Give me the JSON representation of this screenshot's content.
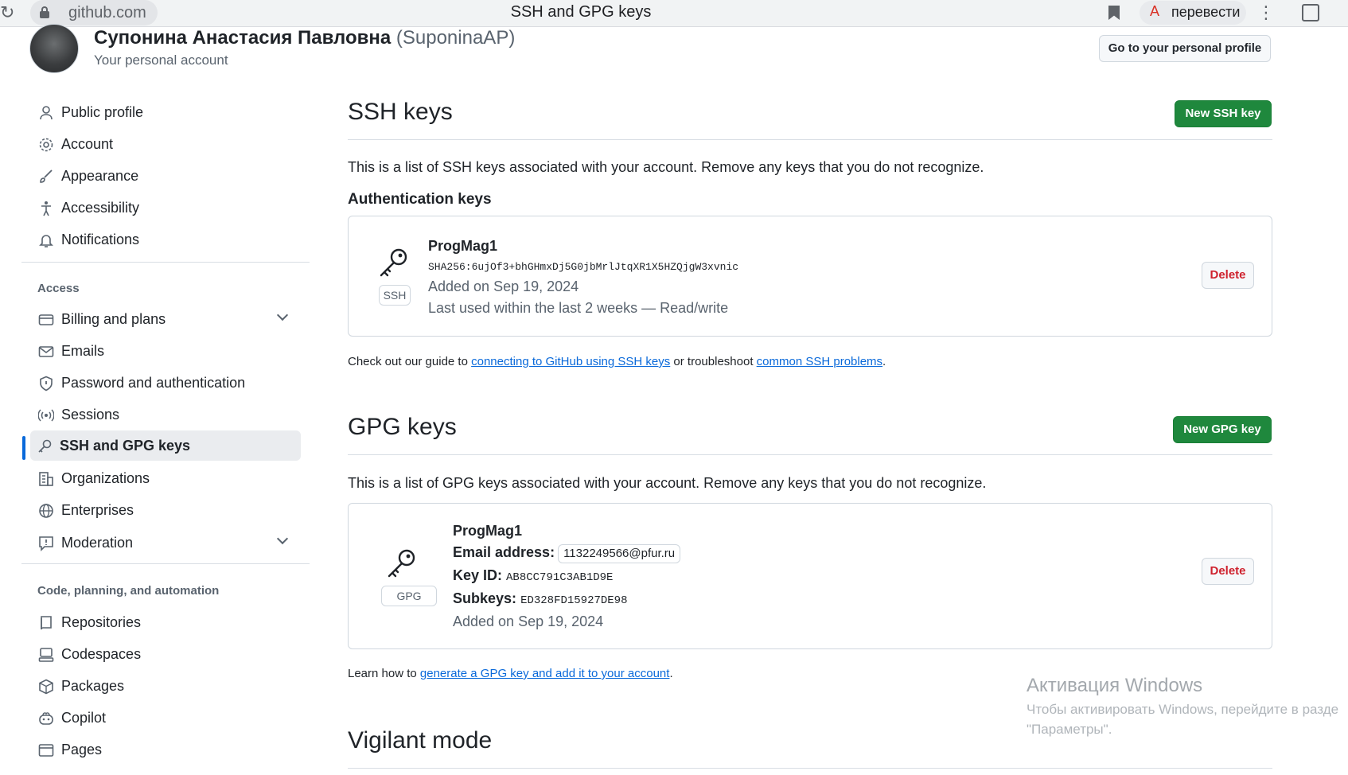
{
  "browser": {
    "domain": "github.com",
    "tab_title": "SSH and GPG keys",
    "translate_label": "перевести",
    "menu_glyph": "⋮",
    "reload_glyph": "↻"
  },
  "header": {
    "display_name": "Супонина Анастасия Павловна",
    "login": "(SuponinaAP)",
    "subtitle": "Your personal account",
    "profile_button": "Go to your personal profile"
  },
  "sidebar": {
    "items_top": [
      {
        "label": "Public profile",
        "icon": "person-icon"
      },
      {
        "label": "Account",
        "icon": "gear-icon"
      },
      {
        "label": "Appearance",
        "icon": "paintbrush-icon"
      },
      {
        "label": "Accessibility",
        "icon": "accessibility-icon"
      },
      {
        "label": "Notifications",
        "icon": "bell-icon"
      }
    ],
    "access_heading": "Access",
    "items_access": [
      {
        "label": "Billing and plans",
        "icon": "credit-card-icon",
        "expandable": true
      },
      {
        "label": "Emails",
        "icon": "mail-icon"
      },
      {
        "label": "Password and authentication",
        "icon": "shield-icon"
      },
      {
        "label": "Sessions",
        "icon": "broadcast-icon"
      },
      {
        "label": "SSH and GPG keys",
        "icon": "key-icon",
        "active": true
      },
      {
        "label": "Organizations",
        "icon": "organization-icon"
      },
      {
        "label": "Enterprises",
        "icon": "globe-icon"
      },
      {
        "label": "Moderation",
        "icon": "report-icon",
        "expandable": true
      }
    ],
    "code_heading": "Code, planning, and automation",
    "items_code": [
      {
        "label": "Repositories",
        "icon": "repo-icon"
      },
      {
        "label": "Codespaces",
        "icon": "codespaces-icon"
      },
      {
        "label": "Packages",
        "icon": "package-icon"
      },
      {
        "label": "Copilot",
        "icon": "copilot-icon"
      },
      {
        "label": "Pages",
        "icon": "browser-icon"
      }
    ]
  },
  "ssh": {
    "title": "SSH keys",
    "new_button": "New SSH key",
    "description": "This is a list of SSH keys associated with your account. Remove any keys that you do not recognize.",
    "auth_heading": "Authentication keys",
    "key": {
      "name": "ProgMag1",
      "badge": "SSH",
      "fingerprint": "SHA256:6ujOf3+bhGHmxDj5G0jbMrlJtqXR1X5HZQjgW3xvnic",
      "added": "Added on Sep 19, 2024",
      "last_used": "Last used within the last 2 weeks — Read/write",
      "delete_label": "Delete"
    },
    "hint": {
      "prefix": "Check out our guide to ",
      "link1": "connecting to GitHub using SSH keys",
      "middle": " or troubleshoot ",
      "link2": "common SSH problems",
      "suffix": "."
    }
  },
  "gpg": {
    "title": "GPG keys",
    "new_button": "New GPG key",
    "description": "This is a list of GPG keys associated with your account. Remove any keys that you do not recognize.",
    "key": {
      "name": "ProgMag1",
      "badge": "GPG",
      "email_label": "Email address:",
      "email": "1132249566@pfur.ru",
      "keyid_label": "Key ID:",
      "keyid": "AB8CC791C3AB1D9E",
      "subkeys_label": "Subkeys:",
      "subkeys": "ED328FD15927DE98",
      "added": "Added on Sep 19, 2024",
      "delete_label": "Delete"
    },
    "hint": {
      "prefix": "Learn how to ",
      "link": "generate a GPG key and add it to your account",
      "suffix": "."
    }
  },
  "vigilant": {
    "title": "Vigilant mode"
  },
  "watermark": {
    "title": "Активация Windows",
    "line1": "Чтобы активировать Windows, перейдите в разде",
    "line2": "\"Параметры\"."
  }
}
